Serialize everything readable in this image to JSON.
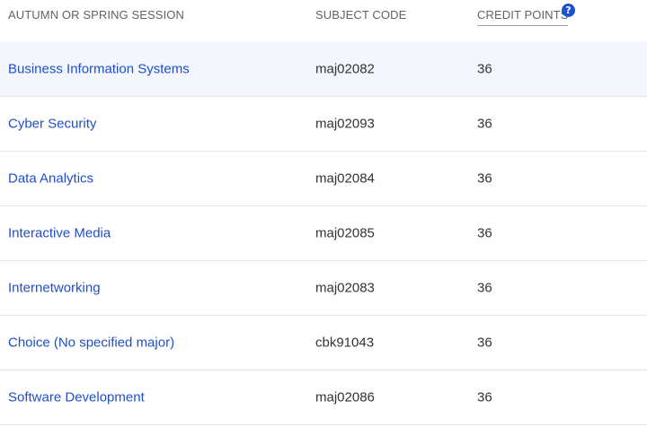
{
  "table": {
    "headers": {
      "session": "AUTUMN OR SPRING SESSION",
      "code": "SUBJECT CODE",
      "credit": "CREDIT POINTS",
      "help_icon": "?"
    },
    "rows": [
      {
        "name": "Business Information Systems",
        "code": "maj02082",
        "credit": "36"
      },
      {
        "name": "Cyber Security",
        "code": "maj02093",
        "credit": "36"
      },
      {
        "name": "Data Analytics",
        "code": "maj02084",
        "credit": "36"
      },
      {
        "name": "Interactive Media",
        "code": "maj02085",
        "credit": "36"
      },
      {
        "name": "Internetworking",
        "code": "maj02083",
        "credit": "36"
      },
      {
        "name": "Choice (No specified major)",
        "code": "cbk91043",
        "credit": "36"
      },
      {
        "name": "Software Development",
        "code": "maj02086",
        "credit": "36"
      }
    ]
  },
  "colors": {
    "link": "#1f4fc6",
    "header_text": "#5f6368",
    "highlight_row": "#f3f6fc",
    "help_icon_bg": "#1a4fd6"
  },
  "icons": {
    "help": "help-circle-icon"
  }
}
